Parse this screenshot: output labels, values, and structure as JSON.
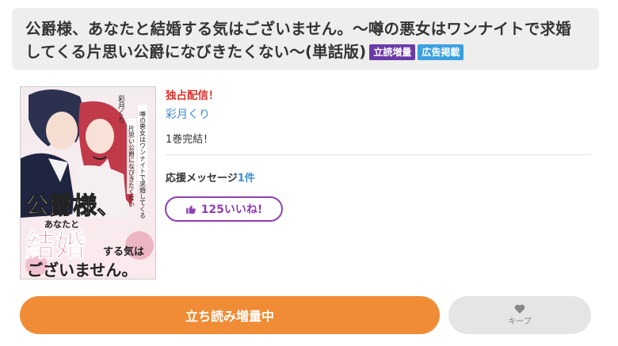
{
  "header": {
    "title": "公爵様、あなたと結婚する気はございません。〜噂の悪女はワンナイトで求婚してくる片思い公爵になびきたくない〜(単話版)",
    "badges": [
      "立読増量",
      "広告掲載"
    ],
    "badge_colors": [
      "#6a3aa6",
      "#3aa0e0"
    ]
  },
  "cover": {
    "author_vertical": "彩月くり",
    "title_line1": "公爵様、",
    "title_line2": "あなたと",
    "title_line3": "結婚",
    "title_line4": "する気は",
    "title_line5": "ございません。",
    "subtitle_vertical_1": "噂の悪女はワンナイトで求婚してくる",
    "subtitle_vertical_2": "片思い公爵になびきたくない"
  },
  "info": {
    "exclusive": "独占配信！",
    "author": "彩月くり",
    "volumes": "1巻完結！",
    "message_label": "応援メッセージ",
    "message_count": "1件",
    "like_label": "125いいね!"
  },
  "actions": {
    "read_label": "立ち読み増量中",
    "keep_label": "キープ"
  },
  "colors": {
    "accent_orange": "#f08c35",
    "like_purple": "#8f3fb6",
    "link_blue": "#3a8fd1",
    "exclusive_red": "#d9332e"
  }
}
